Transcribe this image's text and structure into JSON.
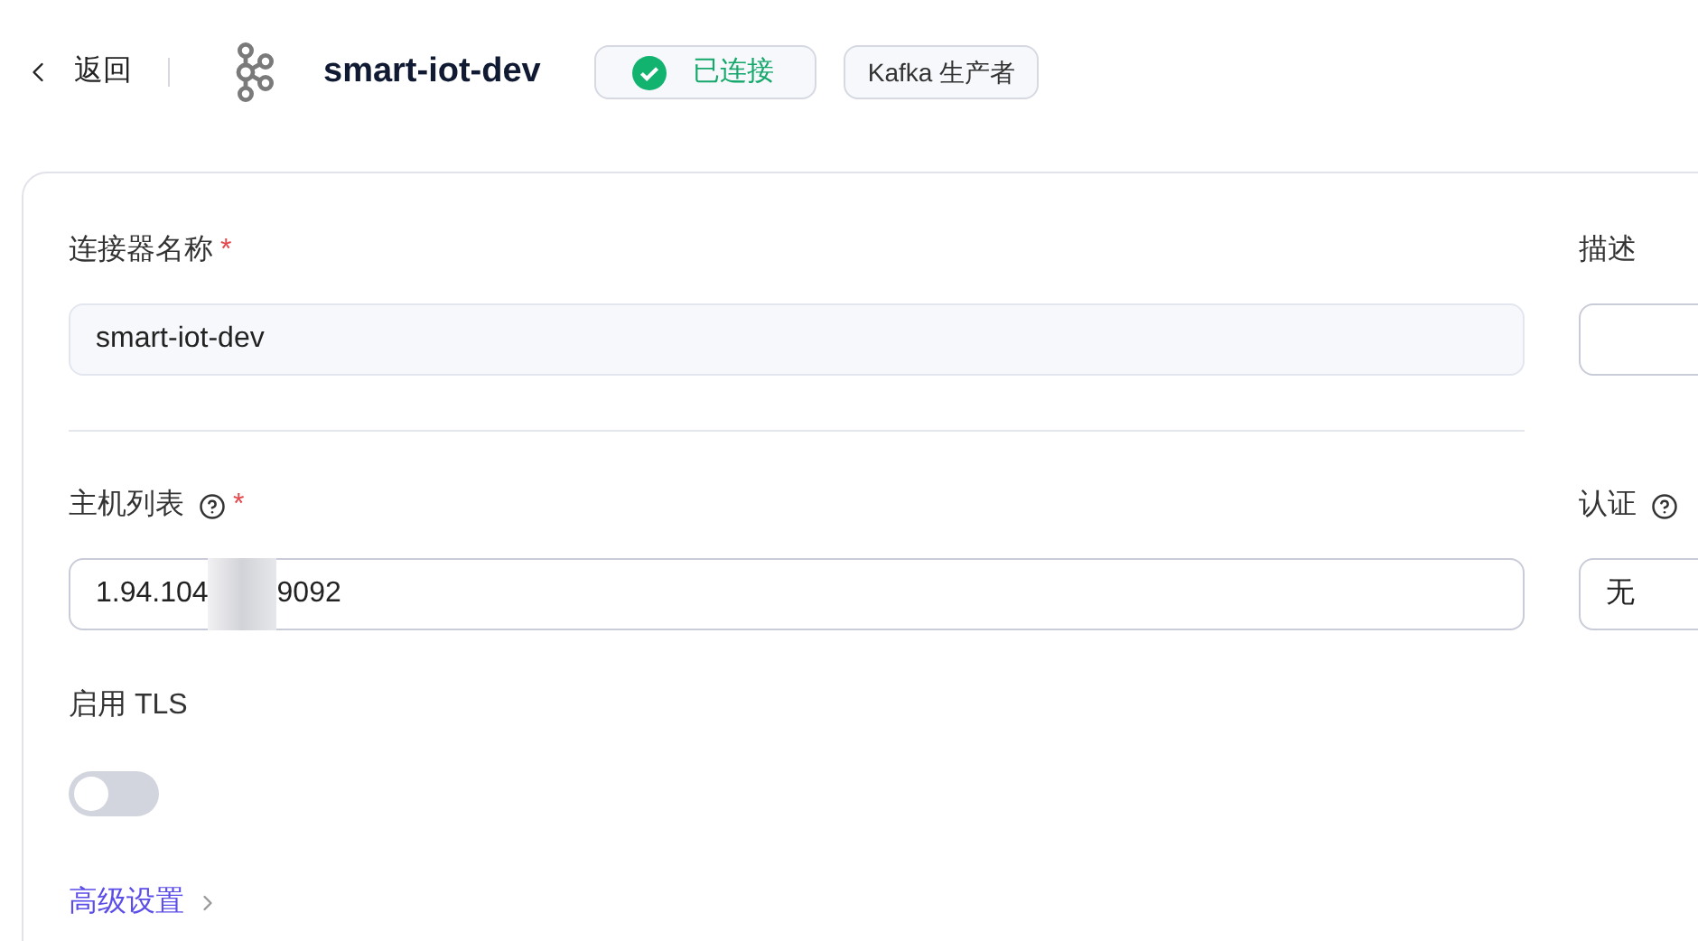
{
  "header": {
    "back": "返回",
    "title": "smart-iot-dev",
    "status": {
      "label": "已连接",
      "connected": true
    },
    "tag": "Kafka 生产者"
  },
  "form": {
    "rows": [
      {
        "left": {
          "label": "连接器名称",
          "required_mark": "*",
          "help": false,
          "value_parts": [
            "smart-iot-dev"
          ],
          "readonly": true
        },
        "right": {
          "label": "描述",
          "help": false
        }
      },
      {
        "left": {
          "label": "主机列表",
          "required_mark": "*",
          "help": true,
          "value_parts": [
            "1.94.104",
            "9092"
          ],
          "readonly": false
        },
        "right": {
          "label": "认证",
          "help": true,
          "value_parts": [
            "无"
          ]
        }
      }
    ],
    "tls": {
      "label": "启用 TLS",
      "on": false
    },
    "advanced": {
      "label": "高级设置"
    }
  }
}
